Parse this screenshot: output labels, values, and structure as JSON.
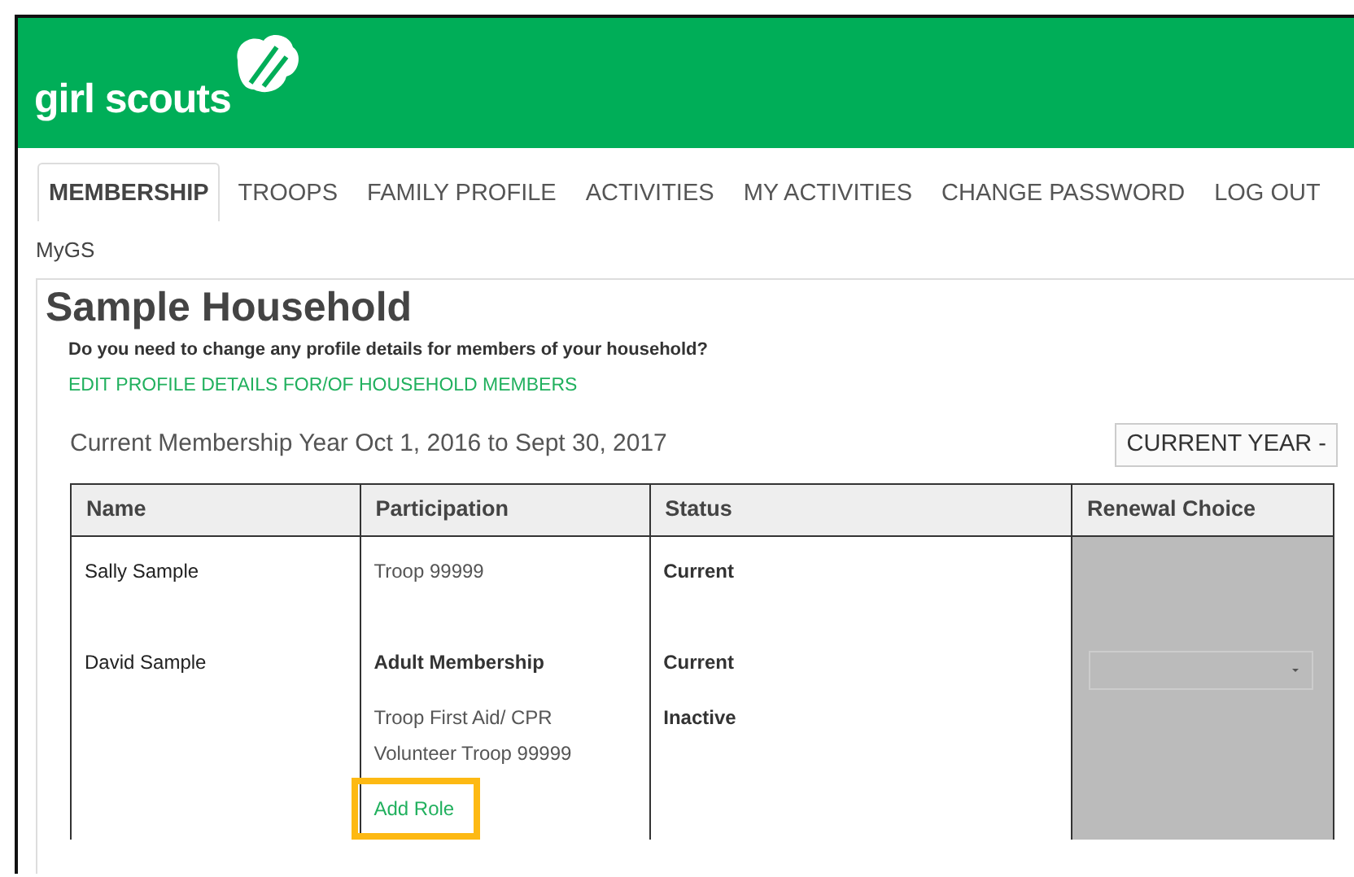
{
  "header": {
    "logo_text": "girl scouts"
  },
  "tabs": [
    {
      "label": "MEMBERSHIP",
      "selected": true
    },
    {
      "label": "TROOPS",
      "selected": false
    },
    {
      "label": "FAMILY PROFILE",
      "selected": false
    },
    {
      "label": "ACTIVITIES",
      "selected": false
    },
    {
      "label": "MY ACTIVITIES",
      "selected": false
    },
    {
      "label": "CHANGE PASSWORD",
      "selected": false
    },
    {
      "label": "LOG OUT",
      "selected": false
    }
  ],
  "breadcrumb": "MyGS",
  "household": {
    "title": "**Sample** Household",
    "question": "Do you need to change any profile details for members of your household?",
    "edit_link": "EDIT PROFILE DETAILS FOR/OF HOUSEHOLD MEMBERS",
    "membership_year": "Current Membership Year Oct 1, 2016 to Sept 30, 2017",
    "year_button": "CURRENT YEAR -"
  },
  "table": {
    "columns": [
      "Name",
      "Participation",
      "Status",
      "Renewal Choice"
    ],
    "rows": [
      {
        "name": "Sally Sample",
        "renewal_select": false,
        "lines": [
          {
            "kind": "plain",
            "text": "Troop  99999",
            "status": "Current"
          }
        ]
      },
      {
        "name": "David Sample",
        "renewal_select": true,
        "lines": [
          {
            "kind": "role",
            "text": "Adult Membership",
            "status": "Current"
          },
          {
            "kind": "plain",
            "text": "Troop First Aid/ CPR",
            "status": "Inactive"
          },
          {
            "kind": "plain",
            "text": "Volunteer Troop  99999"
          },
          {
            "kind": "link",
            "text": "Add Role",
            "highlighted": true
          }
        ]
      }
    ]
  }
}
